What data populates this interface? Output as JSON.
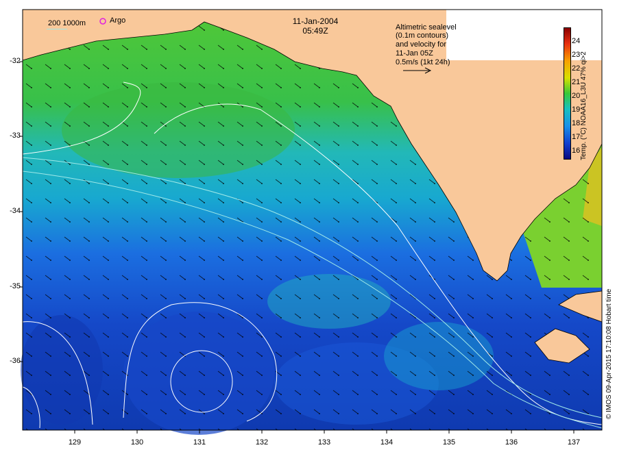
{
  "map": {
    "date": "11-Jan-2004",
    "time": "05:49Z",
    "depth_legend": "200 1000m",
    "argo_label": "Argo",
    "altimetry_note": [
      "Altimetric sealevel",
      "(0.1m contours)",
      "and velocity for",
      "11-Jan 05Z",
      "0.5m/s (1kt 24h)"
    ],
    "lat_ticks": [
      "-32",
      "-33",
      "-34",
      "-35",
      "-36"
    ],
    "lon_ticks": [
      "129",
      "130",
      "131",
      "132",
      "133",
      "134",
      "135",
      "136",
      "137"
    ],
    "colorbar": {
      "label": "Temp. (°C) NOAA16_L3U 47% qi>2",
      "ticks": [
        "24",
        "23",
        "22",
        "21",
        "20",
        "19",
        "18",
        "17",
        "16"
      ]
    },
    "credit": "© IMOS 09-Apr-2015 17:10:08 Hobart time",
    "colors": {
      "land": "#f9c89a",
      "warm_green": "#3cc832",
      "cool_blue": "#1a5cd8",
      "deep_blue": "#0c2a9a",
      "cyan": "#20c0d8",
      "argo": "#e020e0"
    }
  }
}
